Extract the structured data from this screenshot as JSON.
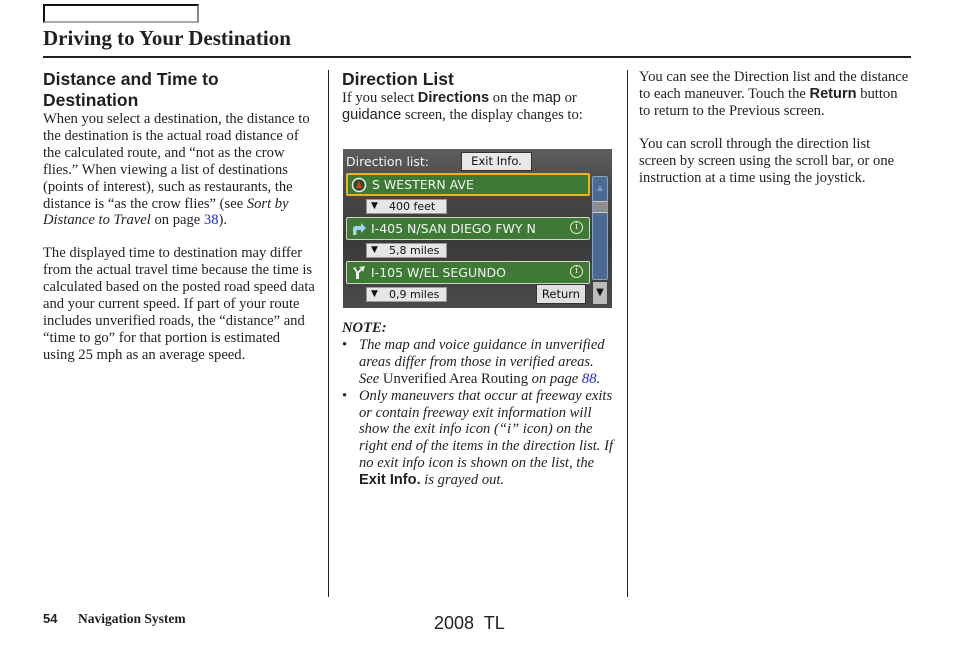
{
  "header": {
    "title": "Driving to Your Destination"
  },
  "left_column": {
    "heading": "Distance and Time to Destination",
    "p1_text": "When you select a destination, the distance to the destination is the actual road distance of the calculated route, and “not as the crow flies.” When viewing a list of destinations (points of interest), such as restaurants, the distance is “as the crow flies” (see ",
    "p1_ref": "Sort by Distance to Travel",
    "p1_mid": " on page ",
    "p1_page": "38",
    "p1_end": ").",
    "p2": "The displayed time to destination may differ from the actual travel time because the time is calculated based on the posted road speed data and your current speed. If part of your route includes unverified roads, the “distance” and “time to go” for that portion is estimated using 25 mph as an average speed."
  },
  "middle_column": {
    "heading": "Direction List",
    "intro_a": "If you select ",
    "intro_directions": "Directions",
    "intro_b": " on the ",
    "intro_map": "map",
    "intro_c": " or ",
    "intro_guidance": "guidance",
    "intro_d": " screen, the display changes to:",
    "note_label": "NOTE:",
    "notes": [
      {
        "a": "The map and voice guidance in unverified areas differ from those in verified areas. See ",
        "ref": "Unverified Area Routing",
        "b": " on page ",
        "page": "88",
        "c": "."
      },
      {
        "a": "Only maneuvers that occur at freeway exits or contain freeway exit information will show the exit info icon (“i” icon) on the right end of the items in the direction list. If no exit info icon is shown on the list, the ",
        "bold": "Exit Info.",
        "c": " is grayed out."
      }
    ]
  },
  "nav_screen": {
    "title": "Direction list:",
    "exit_info_button": "Exit Info.",
    "return_button": "Return",
    "items": [
      {
        "icon": "start-compass-icon",
        "label": "S WESTERN AVE",
        "distance": "400 feet",
        "has_info": false,
        "selected": true
      },
      {
        "icon": "turn-right-arrow-icon",
        "label": "I-405 N/SAN DIEGO FWY N",
        "distance": "5,8 miles",
        "has_info": true,
        "selected": false
      },
      {
        "icon": "fork-right-icon",
        "label": "I-105 W/EL SEGUNDO",
        "distance": "0,9 miles",
        "has_info": true,
        "selected": false
      }
    ],
    "info_glyph": "i",
    "down_glyph": "▼",
    "up_glyph": "▲",
    "colors": {
      "row_green": "#3e7a35",
      "selection": "#f0b020",
      "scrollbar": "#4b6b96"
    }
  },
  "right_column": {
    "p1_a": "You can see the Direction list and the distance to each maneuver. Touch the ",
    "p1_bold": "Return",
    "p1_b": " button to return to the Previous screen.",
    "p2": "You can scroll through the direction list screen by screen using the scroll bar, or one instruction at a time using the joystick."
  },
  "footer": {
    "page_number": "54",
    "section": "Navigation System",
    "model": "2008  TL"
  }
}
